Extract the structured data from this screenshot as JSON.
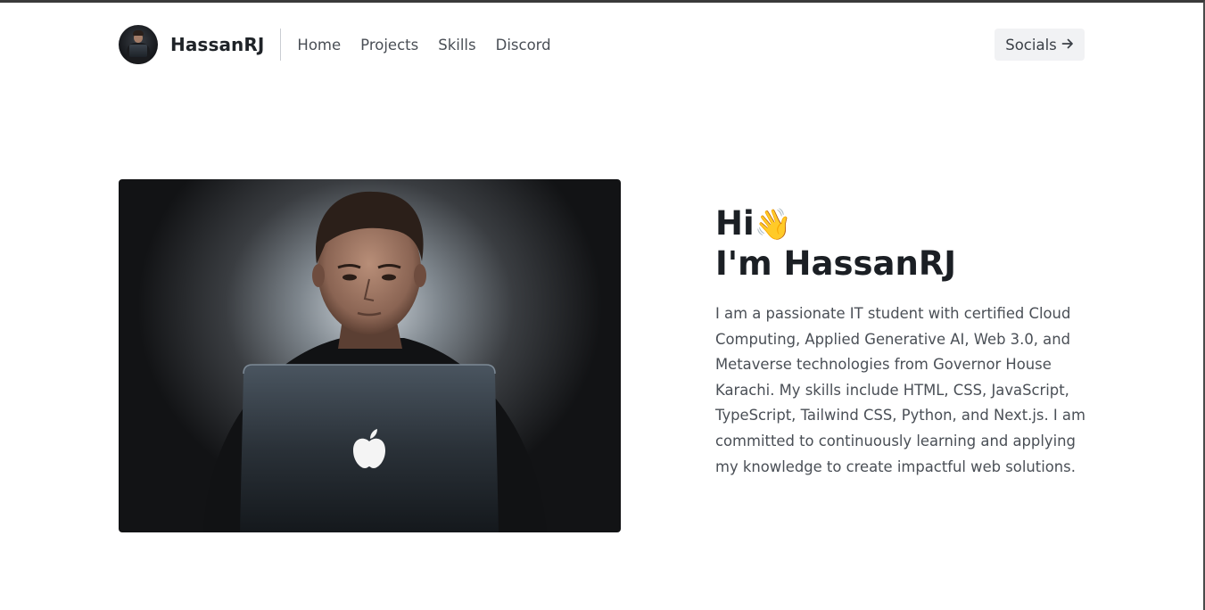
{
  "header": {
    "brand": "HassanRJ",
    "nav": [
      "Home",
      "Projects",
      "Skills",
      "Discord"
    ],
    "socials_label": "Socials",
    "socials_icon": "arrow-right-icon"
  },
  "hero": {
    "greeting_hi": "Hi",
    "wave_emoji": "👋",
    "greeting_name": "I'm HassanRJ",
    "bio": "I am a passionate IT student with certified Cloud Computing, Applied Generative AI, Web 3.0, and Metaverse technologies from Governor House Karachi. My skills include HTML, CSS, JavaScript, TypeScript, Tailwind CSS, Python, and Next.js. I am committed to continuously learning and applying my knowledge to create impactful web solutions."
  },
  "colors": {
    "text_dark": "#1b1f24",
    "text_muted": "#4a4f56",
    "button_bg": "#f1f2f4"
  }
}
